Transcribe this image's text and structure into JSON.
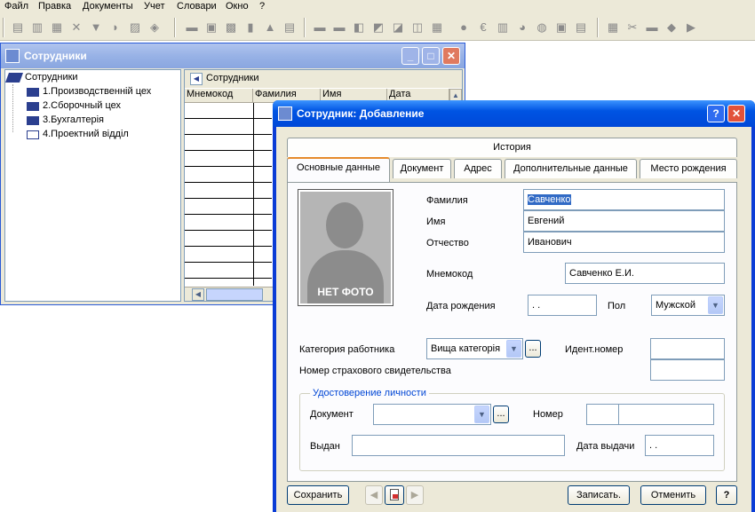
{
  "menu": [
    "Файл",
    "Правка",
    "Документы",
    "Учет",
    "Словари",
    "Окно",
    "?"
  ],
  "win1": {
    "title": "Сотрудники",
    "tree": {
      "root": "Сотрудники",
      "items": [
        "1.Производственній цех",
        "2.Сборочный цех",
        "3.Бухгалтерія",
        "4.Проектний відділ"
      ]
    },
    "grid": {
      "nav_label": "Сотрудники",
      "columns": [
        "Мнемокод",
        "Фамилия",
        "Имя",
        "Дата рождени"
      ]
    }
  },
  "win2": {
    "title": "Сотрудник: Добавление",
    "tabs_top": [
      "История"
    ],
    "tabs": [
      "Основные данные",
      "Документ",
      "Адрес",
      "Дополнительные данные",
      "Место рождения"
    ],
    "photo_label": "НЕТ ФОТО",
    "fields": {
      "lastname_label": "Фамилия",
      "lastname": "Савченко",
      "firstname_label": "Имя",
      "firstname": "Евгений",
      "patronymic_label": "Отчество",
      "patronymic": "Иванович",
      "mnemo_label": "Мнемокод",
      "mnemo": "Савченко Е.И.",
      "birth_label": "Дата рождения",
      "birth": " .  .",
      "sex_label": "Пол",
      "sex": "Мужской",
      "category_label": "Категория работника",
      "category": "Вища категорія",
      "ident_label": "Идент.номер",
      "insurance_label": "Номер страхового свидетельства"
    },
    "idgroup": {
      "legend": "Удостоверение личности",
      "doc_label": "Документ",
      "number_label": "Номер",
      "issued_label": "Выдан",
      "issue_date_label": "Дата выдачи",
      "issue_date": " .  ."
    },
    "buttons": {
      "save": "Сохранить",
      "write": "Записать.",
      "cancel": "Отменить",
      "help": "?",
      "dots": "..."
    }
  }
}
